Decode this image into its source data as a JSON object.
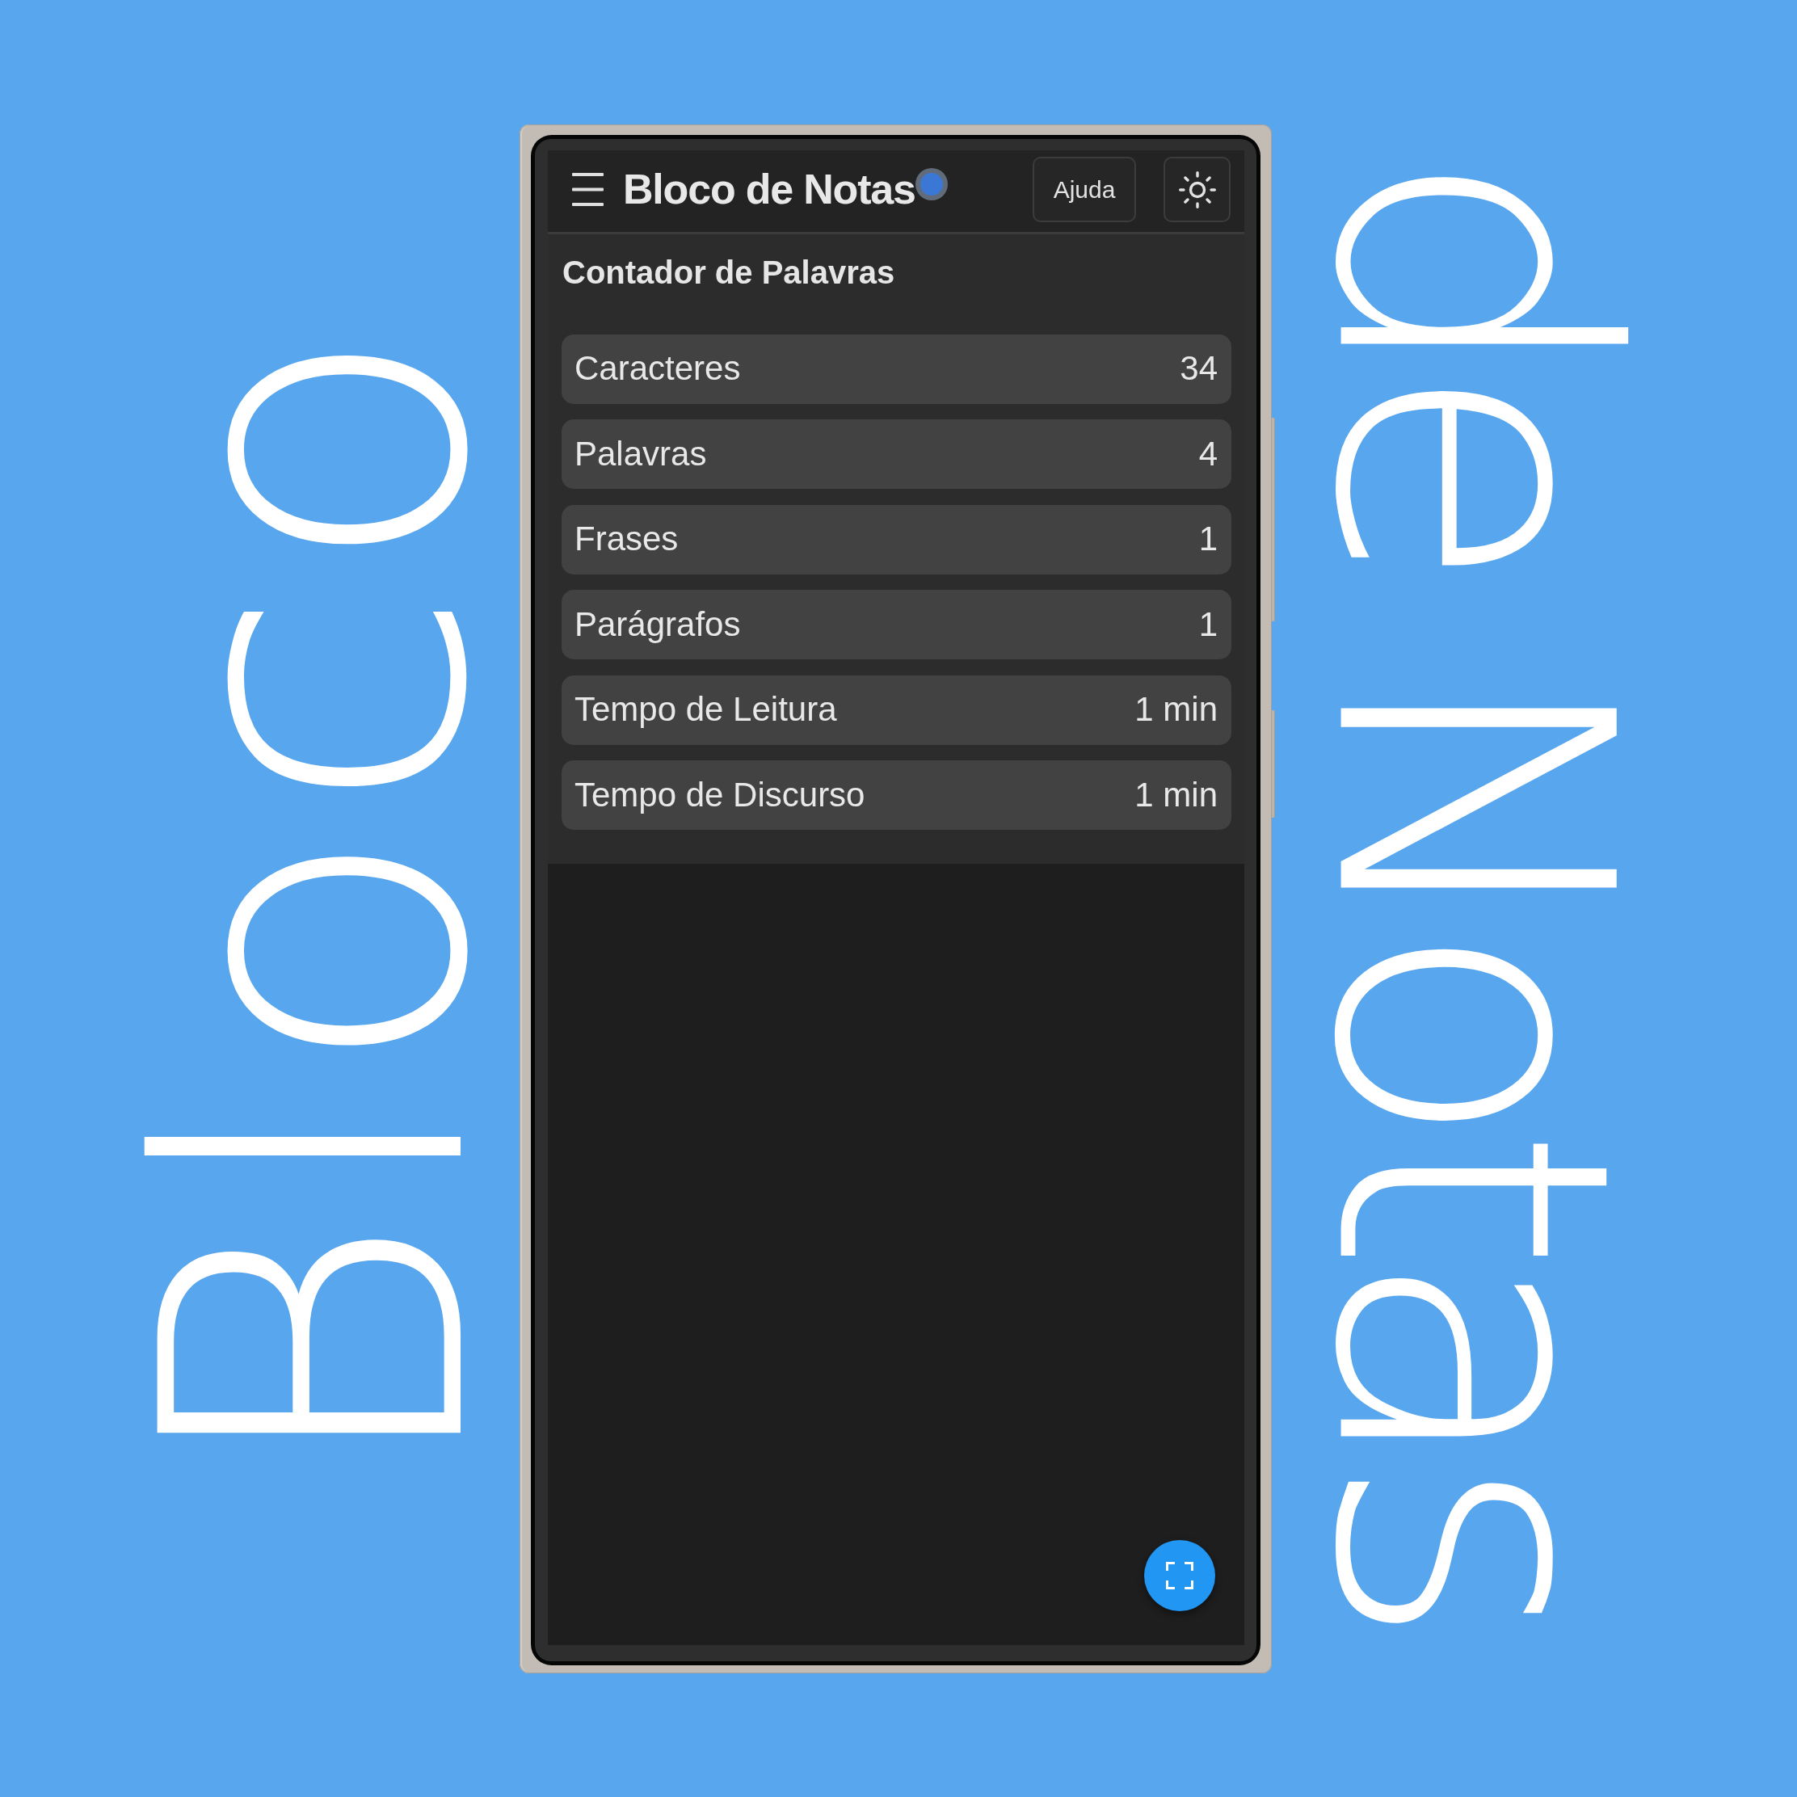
{
  "banner": {
    "left_text": "Bloco",
    "right_text": "de Notas"
  },
  "app_bar": {
    "title": "Bloco de Notas",
    "help_button": "Ajuda"
  },
  "word_counter": {
    "title": "Contador de Palavras",
    "stats": [
      {
        "label": "Caracteres",
        "value": "34"
      },
      {
        "label": "Palavras",
        "value": "4"
      },
      {
        "label": "Frases",
        "value": "1"
      },
      {
        "label": "Parágrafos",
        "value": "1"
      },
      {
        "label": "Tempo de Leitura",
        "value": "1 min"
      },
      {
        "label": "Tempo de Discurso",
        "value": "1 min"
      }
    ]
  }
}
